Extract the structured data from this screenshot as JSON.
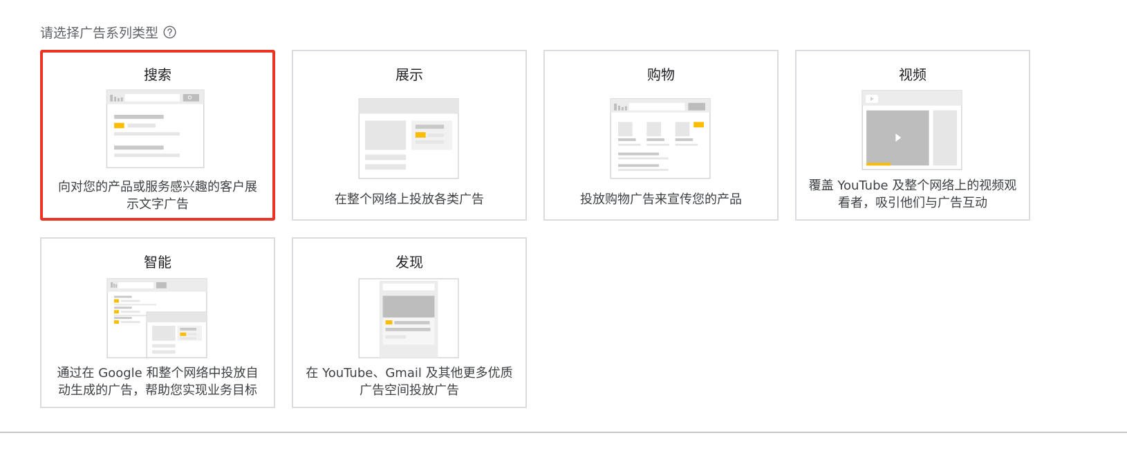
{
  "header": {
    "label": "请选择广告系列类型",
    "help_icon": "help-circle-icon"
  },
  "cards": [
    {
      "id": "search",
      "title": "搜索",
      "description": "向对您的产品或服务感兴趣的客户展示文字广告",
      "selected": true
    },
    {
      "id": "display",
      "title": "展示",
      "description": "在整个网络上投放各类广告",
      "selected": false
    },
    {
      "id": "shopping",
      "title": "购物",
      "description": "投放购物广告来宣传您的产品",
      "selected": false
    },
    {
      "id": "video",
      "title": "视频",
      "description": "覆盖 YouTube 及整个网络上的视频观看者，吸引他们与广告互动",
      "selected": false
    },
    {
      "id": "smart",
      "title": "智能",
      "description": "通过在 Google 和整个网络中投放自动生成的广告，帮助您实现业务目标",
      "selected": false
    },
    {
      "id": "discovery",
      "title": "发现",
      "description": "在 YouTube、Gmail 及其他更多优质广告空间投放广告",
      "selected": false
    }
  ],
  "colors": {
    "selected_border": "#ea3323",
    "card_border": "#dadce0",
    "accent_yellow": "#fbbc04",
    "illus_gray": "#bdbdbd"
  }
}
